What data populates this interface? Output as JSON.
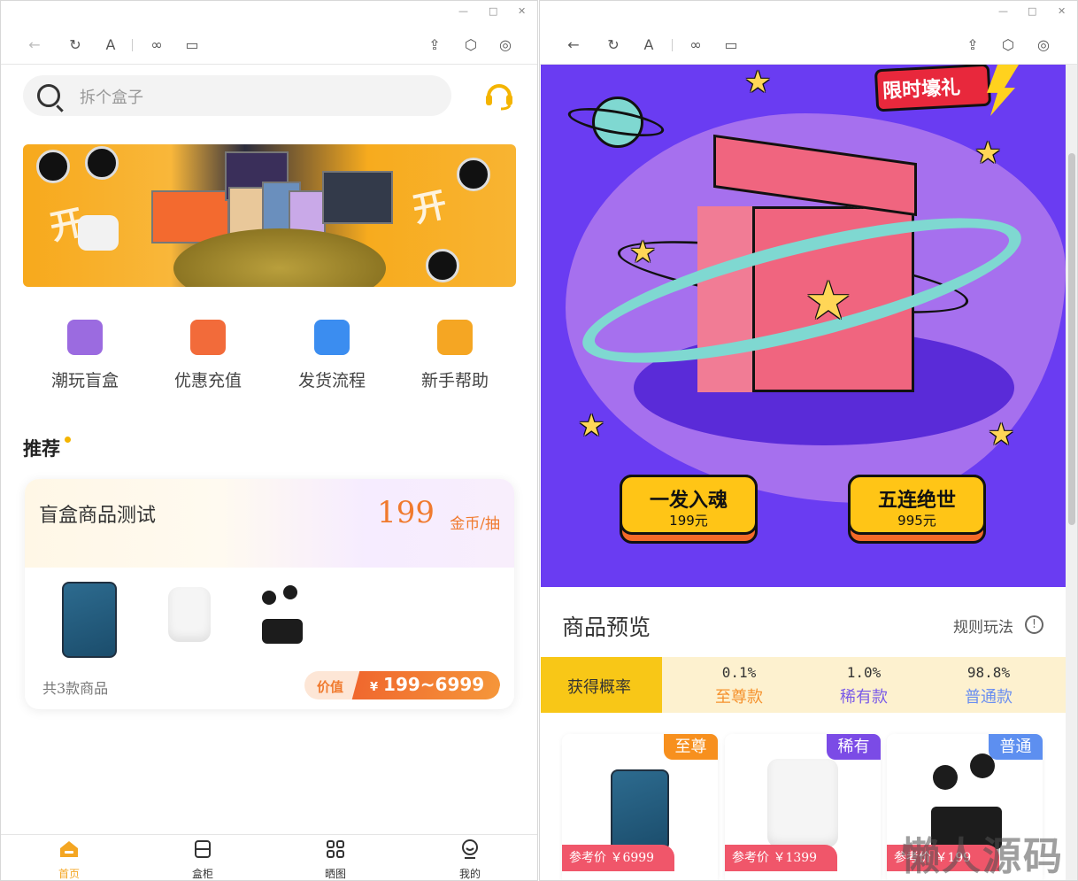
{
  "left": {
    "window_controls": [
      "—",
      "□",
      "✕"
    ],
    "toolbar_icons": [
      "back-arrow-icon",
      "refresh-icon",
      "font-icon",
      "link-icon",
      "window-icon",
      "share-icon",
      "cube-icon",
      "record-icon"
    ],
    "search_placeholder": "拆个盒子",
    "categories": [
      {
        "label": "潮玩盲盒",
        "icon": "gift-box-icon",
        "color": "#9b6be0"
      },
      {
        "label": "优惠充值",
        "icon": "wallet-icon",
        "color": "#f26b3a"
      },
      {
        "label": "发货流程",
        "icon": "truck-icon",
        "color": "#3b8df0"
      },
      {
        "label": "新手帮助",
        "icon": "book-icon",
        "color": "#f5a623"
      }
    ],
    "recommend_title": "推荐",
    "card": {
      "name": "盲盒商品测试",
      "price": "199",
      "unit": "金币/抽",
      "count_text": "共3款商品",
      "value_label": "价值",
      "value_currency": "¥",
      "value_range": "199~6999"
    },
    "tabs": [
      {
        "label": "首页",
        "icon": "home-icon",
        "active": true
      },
      {
        "label": "盒柜",
        "icon": "cabinet-icon",
        "active": false
      },
      {
        "label": "晒图",
        "icon": "grid-icon",
        "active": false
      },
      {
        "label": "我的",
        "icon": "user-icon",
        "active": false
      }
    ]
  },
  "right": {
    "gift_badge": "限时壕礼",
    "draw_buttons": [
      {
        "title": "一发入魂",
        "price": "199元"
      },
      {
        "title": "五连绝世",
        "price": "995元"
      }
    ],
    "preview_title": "商品预览",
    "rules_label": "规则玩法",
    "probability": {
      "header": "获得概率",
      "tiers": [
        {
          "value": "0.1%",
          "name": "至尊款",
          "color": "#f5922e"
        },
        {
          "value": "1.0%",
          "name": "稀有款",
          "color": "#7a5ae8"
        },
        {
          "value": "98.8%",
          "name": "普通款",
          "color": "#6a8ef0"
        }
      ]
    },
    "products": [
      {
        "badge": "至尊",
        "badge_color": "#f7901e",
        "price_label": "参考价",
        "price": "￥6999"
      },
      {
        "badge": "稀有",
        "badge_color": "#7b4be6",
        "price_label": "参考价",
        "price": "￥1399"
      },
      {
        "badge": "普通",
        "badge_color": "#5d8ff0",
        "price_label": "参考价",
        "price": "￥199"
      }
    ],
    "watermark": "懒人源码"
  }
}
